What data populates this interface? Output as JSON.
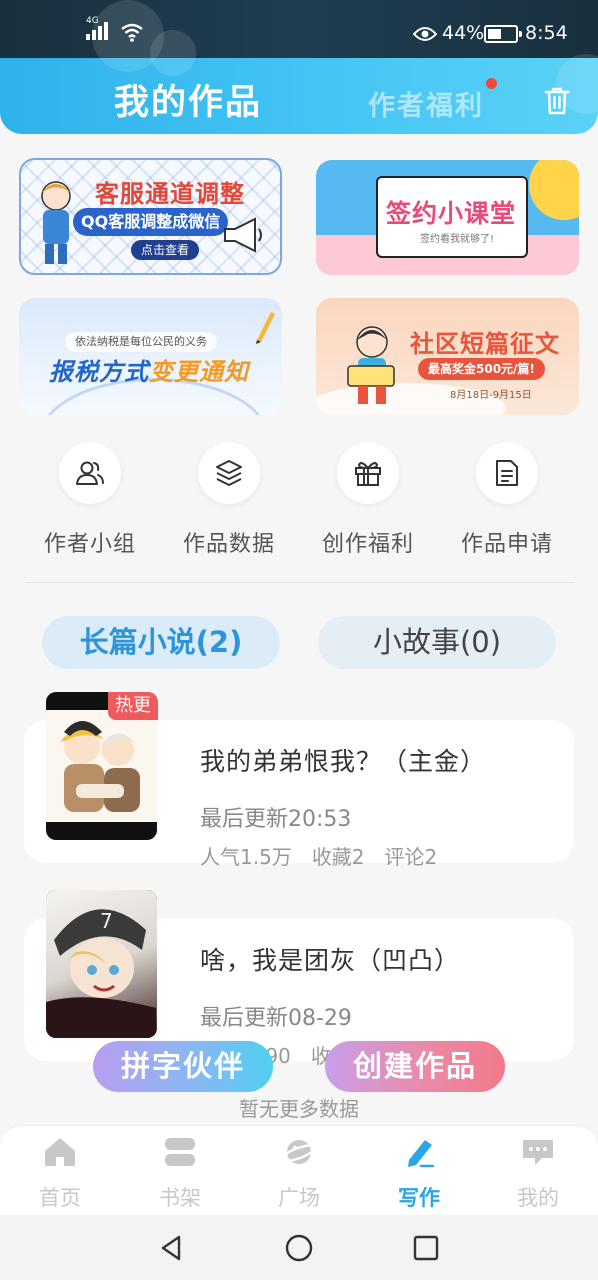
{
  "status_bar": {
    "network": "4G",
    "battery": "44%",
    "battery_level": 0.44,
    "time": "8:54"
  },
  "header": {
    "tab_active": "我的作品",
    "tab_inactive": "作者福利"
  },
  "banners": {
    "service": {
      "title": "客服通道调整",
      "subtitle": "QQ客服调整成微信",
      "button": "点击查看"
    },
    "contract": {
      "title": "签约小课堂",
      "subtitle": "签约看我就够了!"
    },
    "tax": {
      "top": "依法纳税是每位公民的义务",
      "title_a": "报税方式",
      "title_b": "变更通知"
    },
    "contest": {
      "title": "社区短篇征文",
      "prize": "最高奖金500元/篇!",
      "date": "8月18日-9月15日"
    }
  },
  "quick_actions": [
    {
      "label": "作者小组",
      "icon": "people-icon"
    },
    {
      "label": "作品数据",
      "icon": "layers-icon"
    },
    {
      "label": "创作福利",
      "icon": "gift-icon"
    },
    {
      "label": "作品申请",
      "icon": "document-icon"
    }
  ],
  "categories": {
    "long": "长篇小说(2)",
    "short": "小故事(0)"
  },
  "works": [
    {
      "title": "我的弟弟恨我？（主金）",
      "update": "最后更新20:53",
      "stats": [
        "人气1.5万",
        "收藏2",
        "评论2"
      ],
      "badge": "热更"
    },
    {
      "title": "啥，我是团灰（凹凸）",
      "update": "最后更新08-29",
      "stats": [
        "人气2090",
        "收"
      ]
    }
  ],
  "fab": {
    "partner": "拼字伙伴",
    "create": "创建作品"
  },
  "no_more": "暂无更多数据",
  "bottom_nav": [
    {
      "label": "首页",
      "icon": "home-icon"
    },
    {
      "label": "书架",
      "icon": "bookshelf-icon"
    },
    {
      "label": "广场",
      "icon": "planet-icon"
    },
    {
      "label": "写作",
      "icon": "pen-icon"
    },
    {
      "label": "我的",
      "icon": "chat-icon"
    }
  ],
  "colors": {
    "accent": "#2aa5e6",
    "hot": "#ee5a5e",
    "header": "#3bbcf0"
  }
}
